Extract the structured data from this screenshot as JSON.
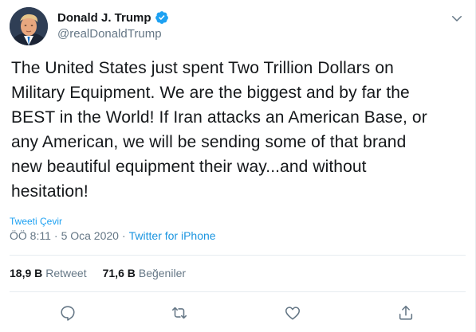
{
  "tweet": {
    "author": {
      "display_name": "Donald J. Trump",
      "handle": "@realDonaldTrump",
      "verified": true
    },
    "text": "The United States just spent Two Trillion Dollars on\nMilitary Equipment. We are the biggest and by far the\nBEST in the World! If Iran attacks an American Base, or\nany American, we will be sending some of that brand\nnew beautiful equipment their way...and without\nhesitation!",
    "translate_label": "Tweeti Çevir",
    "time": "ÖÖ 8:11",
    "separator": "·",
    "date": "5 Oca 2020",
    "source": "Twitter for iPhone",
    "stats": {
      "retweets_count": "18,9 B",
      "retweets_label": "Retweet",
      "likes_count": "71,6 B",
      "likes_label": "Beğeniler"
    }
  },
  "icons": {
    "verified": "verified-badge-icon",
    "caret": "chevron-down-icon",
    "reply": "reply-icon",
    "retweet": "retweet-icon",
    "like": "heart-icon",
    "share": "share-icon"
  },
  "colors": {
    "accent": "#1da1f2",
    "link": "#1b95e0",
    "text": "#14171a",
    "secondary": "#657786",
    "border": "#e6ecf0"
  }
}
